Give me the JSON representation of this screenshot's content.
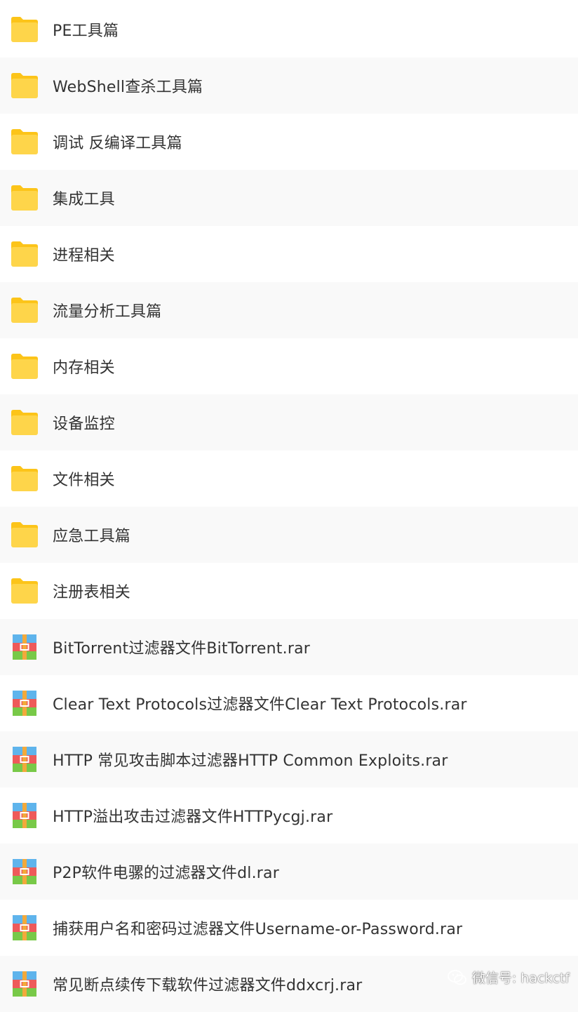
{
  "files": [
    {
      "name": "PE工具篇",
      "type": "folder"
    },
    {
      "name": "WebShell查杀工具篇",
      "type": "folder"
    },
    {
      "name": "调试 反编译工具篇",
      "type": "folder"
    },
    {
      "name": "集成工具",
      "type": "folder"
    },
    {
      "name": "进程相关",
      "type": "folder"
    },
    {
      "name": "流量分析工具篇",
      "type": "folder"
    },
    {
      "name": "内存相关",
      "type": "folder"
    },
    {
      "name": "设备监控",
      "type": "folder"
    },
    {
      "name": "文件相关",
      "type": "folder"
    },
    {
      "name": "应急工具篇",
      "type": "folder"
    },
    {
      "name": "注册表相关",
      "type": "folder"
    },
    {
      "name": "BitTorrent过滤器文件BitTorrent.rar",
      "type": "archive"
    },
    {
      "name": "Clear Text Protocols过滤器文件Clear Text Protocols.rar",
      "type": "archive"
    },
    {
      "name": "HTTP 常见攻击脚本过滤器HTTP Common Exploits.rar",
      "type": "archive"
    },
    {
      "name": "HTTP溢出攻击过滤器文件HTTPycgj.rar",
      "type": "archive"
    },
    {
      "name": "P2P软件电骡的过滤器文件dl.rar",
      "type": "archive"
    },
    {
      "name": "捕获用户名和密码过滤器文件Username-or-Password.rar",
      "type": "archive"
    },
    {
      "name": "常见断点续传下载软件过滤器文件ddxcrj.rar",
      "type": "archive"
    }
  ],
  "icons": {
    "folder": "folder-icon",
    "archive": "archive-icon"
  },
  "colors": {
    "folder_body": "#fed54a",
    "folder_tab": "#fcc419",
    "archive_blue": "#5fb4ec",
    "archive_red": "#ee5a5a",
    "archive_green": "#78c948",
    "archive_strap": "#f2a93b",
    "text": "#333333",
    "row_alt": "#f9f9f9"
  },
  "watermark": {
    "text": "微信号: hackctf"
  }
}
